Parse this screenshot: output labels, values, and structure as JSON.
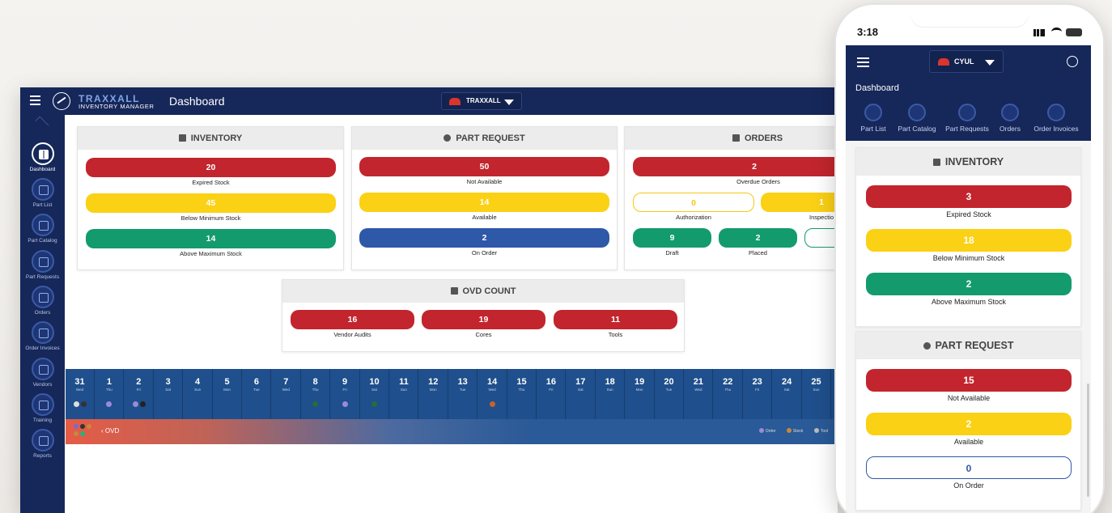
{
  "desktop": {
    "brand_line1": "TRAXXALL",
    "brand_line2": "INVENTORY MANAGER",
    "page_title": "Dashboard",
    "location": "TRAXXALL",
    "sidebar": [
      {
        "label": "Dashboard",
        "active": true
      },
      {
        "label": "Part List"
      },
      {
        "label": "Part Catalog"
      },
      {
        "label": "Part Requests"
      },
      {
        "label": "Orders"
      },
      {
        "label": "Order Invoices"
      },
      {
        "label": "Vendors"
      },
      {
        "label": "Training"
      },
      {
        "label": "Reports"
      }
    ],
    "inventory": {
      "title": "INVENTORY",
      "expired": {
        "value": "20",
        "label": "Expired Stock"
      },
      "below": {
        "value": "45",
        "label": "Below Minimum Stock"
      },
      "above": {
        "value": "14",
        "label": "Above Maximum Stock"
      }
    },
    "part_request": {
      "title": "PART REQUEST",
      "not_available": {
        "value": "50",
        "label": "Not Available"
      },
      "available": {
        "value": "14",
        "label": "Available"
      },
      "on_order": {
        "value": "2",
        "label": "On Order"
      }
    },
    "orders": {
      "title": "ORDERS",
      "overdue": {
        "value": "2",
        "label": "Overdue Orders"
      },
      "authorization": {
        "value": "0",
        "label": "Authorization"
      },
      "inspection": {
        "value": "1",
        "label": "Inspectio"
      },
      "draft": {
        "value": "9",
        "label": "Draft"
      },
      "placed": {
        "value": "2",
        "label": "Placed"
      },
      "in": {
        "value": "",
        "label": "In"
      }
    },
    "ovd_count": {
      "title": "OVD COUNT",
      "vendor_audits": {
        "value": "16",
        "label": "Vendor Audits"
      },
      "cores": {
        "value": "19",
        "label": "Cores"
      },
      "tools": {
        "value": "11",
        "label": "Tools"
      }
    },
    "calendar": [
      {
        "d": "31",
        "w": "Wed"
      },
      {
        "d": "1",
        "w": "Thu"
      },
      {
        "d": "2",
        "w": "Fri"
      },
      {
        "d": "3",
        "w": "Sat"
      },
      {
        "d": "4",
        "w": "Sun"
      },
      {
        "d": "5",
        "w": "Mon"
      },
      {
        "d": "6",
        "w": "Tue"
      },
      {
        "d": "7",
        "w": "Wed"
      },
      {
        "d": "8",
        "w": "Thu"
      },
      {
        "d": "9",
        "w": "Fri"
      },
      {
        "d": "10",
        "w": "Sat"
      },
      {
        "d": "11",
        "w": "Sun"
      },
      {
        "d": "12",
        "w": "Mon"
      },
      {
        "d": "13",
        "w": "Tue"
      },
      {
        "d": "14",
        "w": "Wed"
      },
      {
        "d": "15",
        "w": "Thu"
      },
      {
        "d": "16",
        "w": "Fri"
      },
      {
        "d": "17",
        "w": "Sat"
      },
      {
        "d": "18",
        "w": "Sun"
      },
      {
        "d": "19",
        "w": "Mon"
      },
      {
        "d": "20",
        "w": "Tue"
      },
      {
        "d": "21",
        "w": "Wed"
      },
      {
        "d": "22",
        "w": "Thu"
      },
      {
        "d": "23",
        "w": "Fri"
      },
      {
        "d": "24",
        "w": "Sat"
      },
      {
        "d": "25",
        "w": "Sun"
      }
    ],
    "ovd_bar": {
      "label": "OVD"
    },
    "legend": [
      "Order",
      "Stock",
      "Tool"
    ]
  },
  "phone": {
    "time": "3:18",
    "battery": "47",
    "location": "CYUL",
    "page_title": "Dashboard",
    "tabs": [
      "Part List",
      "Part Catalog",
      "Part Requests",
      "Orders",
      "Order Invoices"
    ],
    "inventory": {
      "title": "INVENTORY",
      "expired": {
        "value": "3",
        "label": "Expired Stock"
      },
      "below": {
        "value": "18",
        "label": "Below Minimum Stock"
      },
      "above": {
        "value": "2",
        "label": "Above Maximum Stock"
      }
    },
    "part_request": {
      "title": "PART REQUEST",
      "not_available": {
        "value": "15",
        "label": "Not Available"
      },
      "available": {
        "value": "2",
        "label": "Available"
      },
      "on_order": {
        "value": "0",
        "label": "On Order"
      }
    }
  },
  "colors": {
    "navy": "#16275a",
    "red": "#c2252d",
    "yellow": "#fad115",
    "green": "#139b6e",
    "blue": "#2e58a8"
  }
}
